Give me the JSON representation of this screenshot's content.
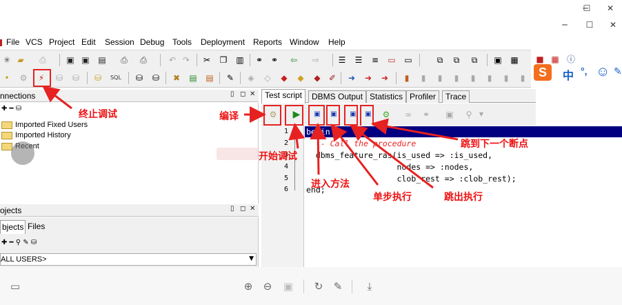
{
  "menu": {
    "items": [
      "File",
      "VCS",
      "Project",
      "Edit",
      "Session",
      "Debug",
      "Tools",
      "Deployment",
      "Reports",
      "Window",
      "Help"
    ]
  },
  "window_controls": {
    "outer": [
      "─",
      "☐",
      "✕"
    ],
    "inner": [
      "─",
      "☐",
      "✕"
    ]
  },
  "connections_panel": {
    "title": "nnections",
    "controls": [
      "▯",
      "◻",
      "✕"
    ],
    "toolbar": "✚ ━ ⛁",
    "tree": [
      "Imported Fixed Users",
      "Imported History",
      "Recent"
    ]
  },
  "objects_panel": {
    "title": "ojects",
    "controls": [
      "▯",
      "◻",
      "✕"
    ],
    "tabs": [
      "bjects",
      "Files"
    ],
    "toolbar": "✚ ━ ⚲ ✎ ⛁",
    "selector_value": "ALL USERS>"
  },
  "editor": {
    "tabs": [
      "Test script",
      "DBMS Output",
      "Statistics",
      "Profiler",
      "Trace"
    ],
    "line_numbers": [
      "1",
      "2",
      "3",
      "4",
      "5",
      "6"
    ],
    "code_lines": [
      "begin",
      "  -- Call the procedure",
      "  dbms_feature_ras(is_used => :is_used,",
      "                   nodes => :nodes,",
      "                   clob_rest => :clob_rest);",
      "end;"
    ]
  },
  "annotations": {
    "stop_debug": "终止调试",
    "compile": "编译",
    "start_debug": "开始调试",
    "step_into": "进入方法",
    "step_over": "单步执行",
    "step_out": "跳出执行",
    "run_to_breakpoint": "跳到下一个断点"
  },
  "ime": {
    "logo": "S",
    "mode": "中",
    "punct": "°,",
    "emoji": "☺",
    "extra": "✎"
  },
  "colors": {
    "annotation_red": "#e62121",
    "selection_navy": "#000080",
    "comment_red": "#ee2222",
    "sogou_orange": "#f36f1e"
  }
}
